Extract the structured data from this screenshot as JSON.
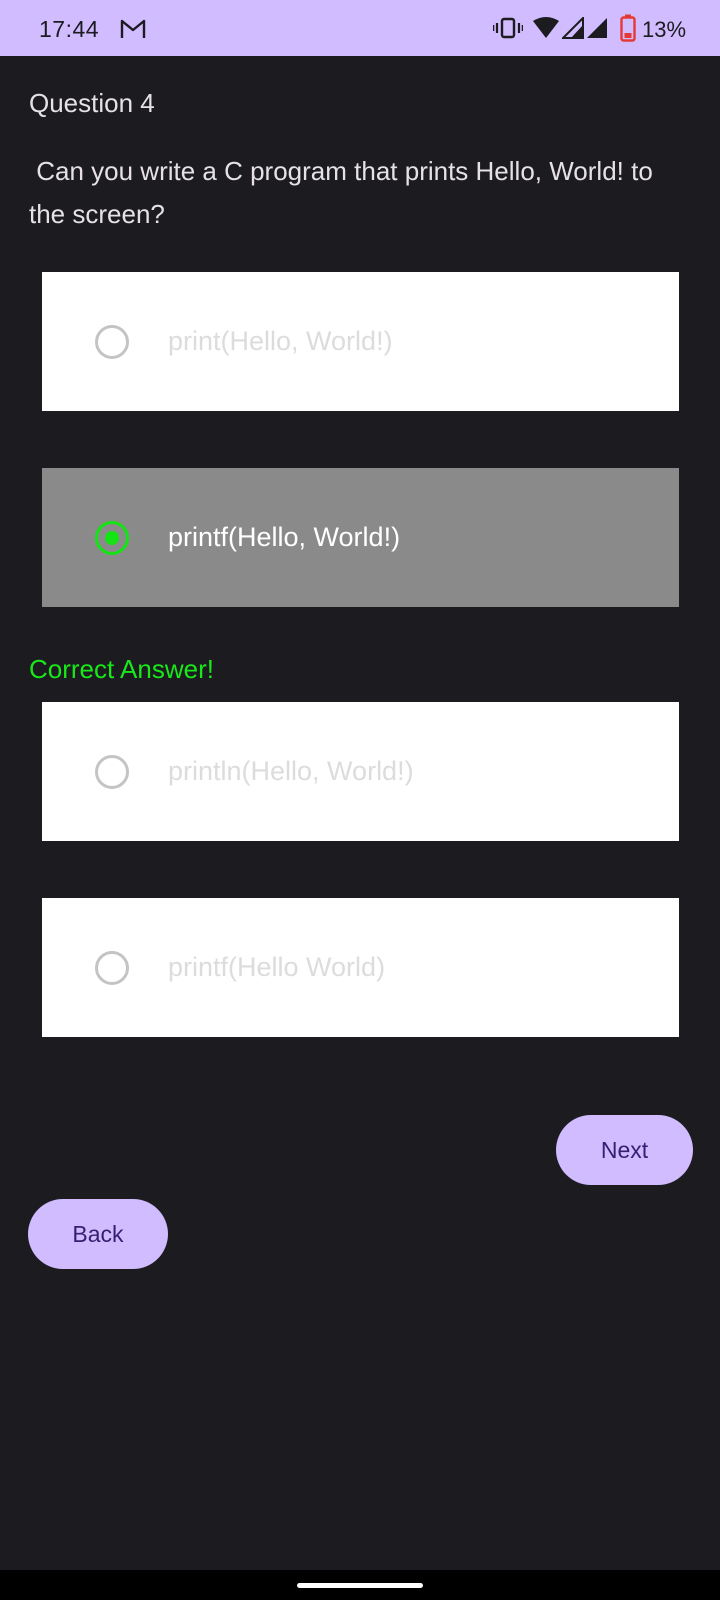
{
  "status_bar": {
    "time": "17:44",
    "battery_percent": "13%",
    "icons": [
      "gmail-icon",
      "vibrate-icon",
      "wifi-icon",
      "signal-icon",
      "signal-icon",
      "battery-low-icon"
    ]
  },
  "quiz": {
    "question_number": "Question 4",
    "question_text": " Can you write a C program that prints Hello, World! to the screen?",
    "options": [
      {
        "label": "print(Hello, World!)",
        "selected": false
      },
      {
        "label": "printf(Hello, World!)",
        "selected": true
      },
      {
        "label": "println(Hello, World!)",
        "selected": false
      },
      {
        "label": "printf(Hello World)",
        "selected": false
      }
    ],
    "feedback": "Correct Answer!"
  },
  "buttons": {
    "next_label": "Next",
    "back_label": "Back"
  },
  "colors": {
    "accent": "#d0bcff",
    "background": "#1c1b20",
    "correct": "#14e414",
    "selected_option_bg": "#8a8a8a"
  }
}
